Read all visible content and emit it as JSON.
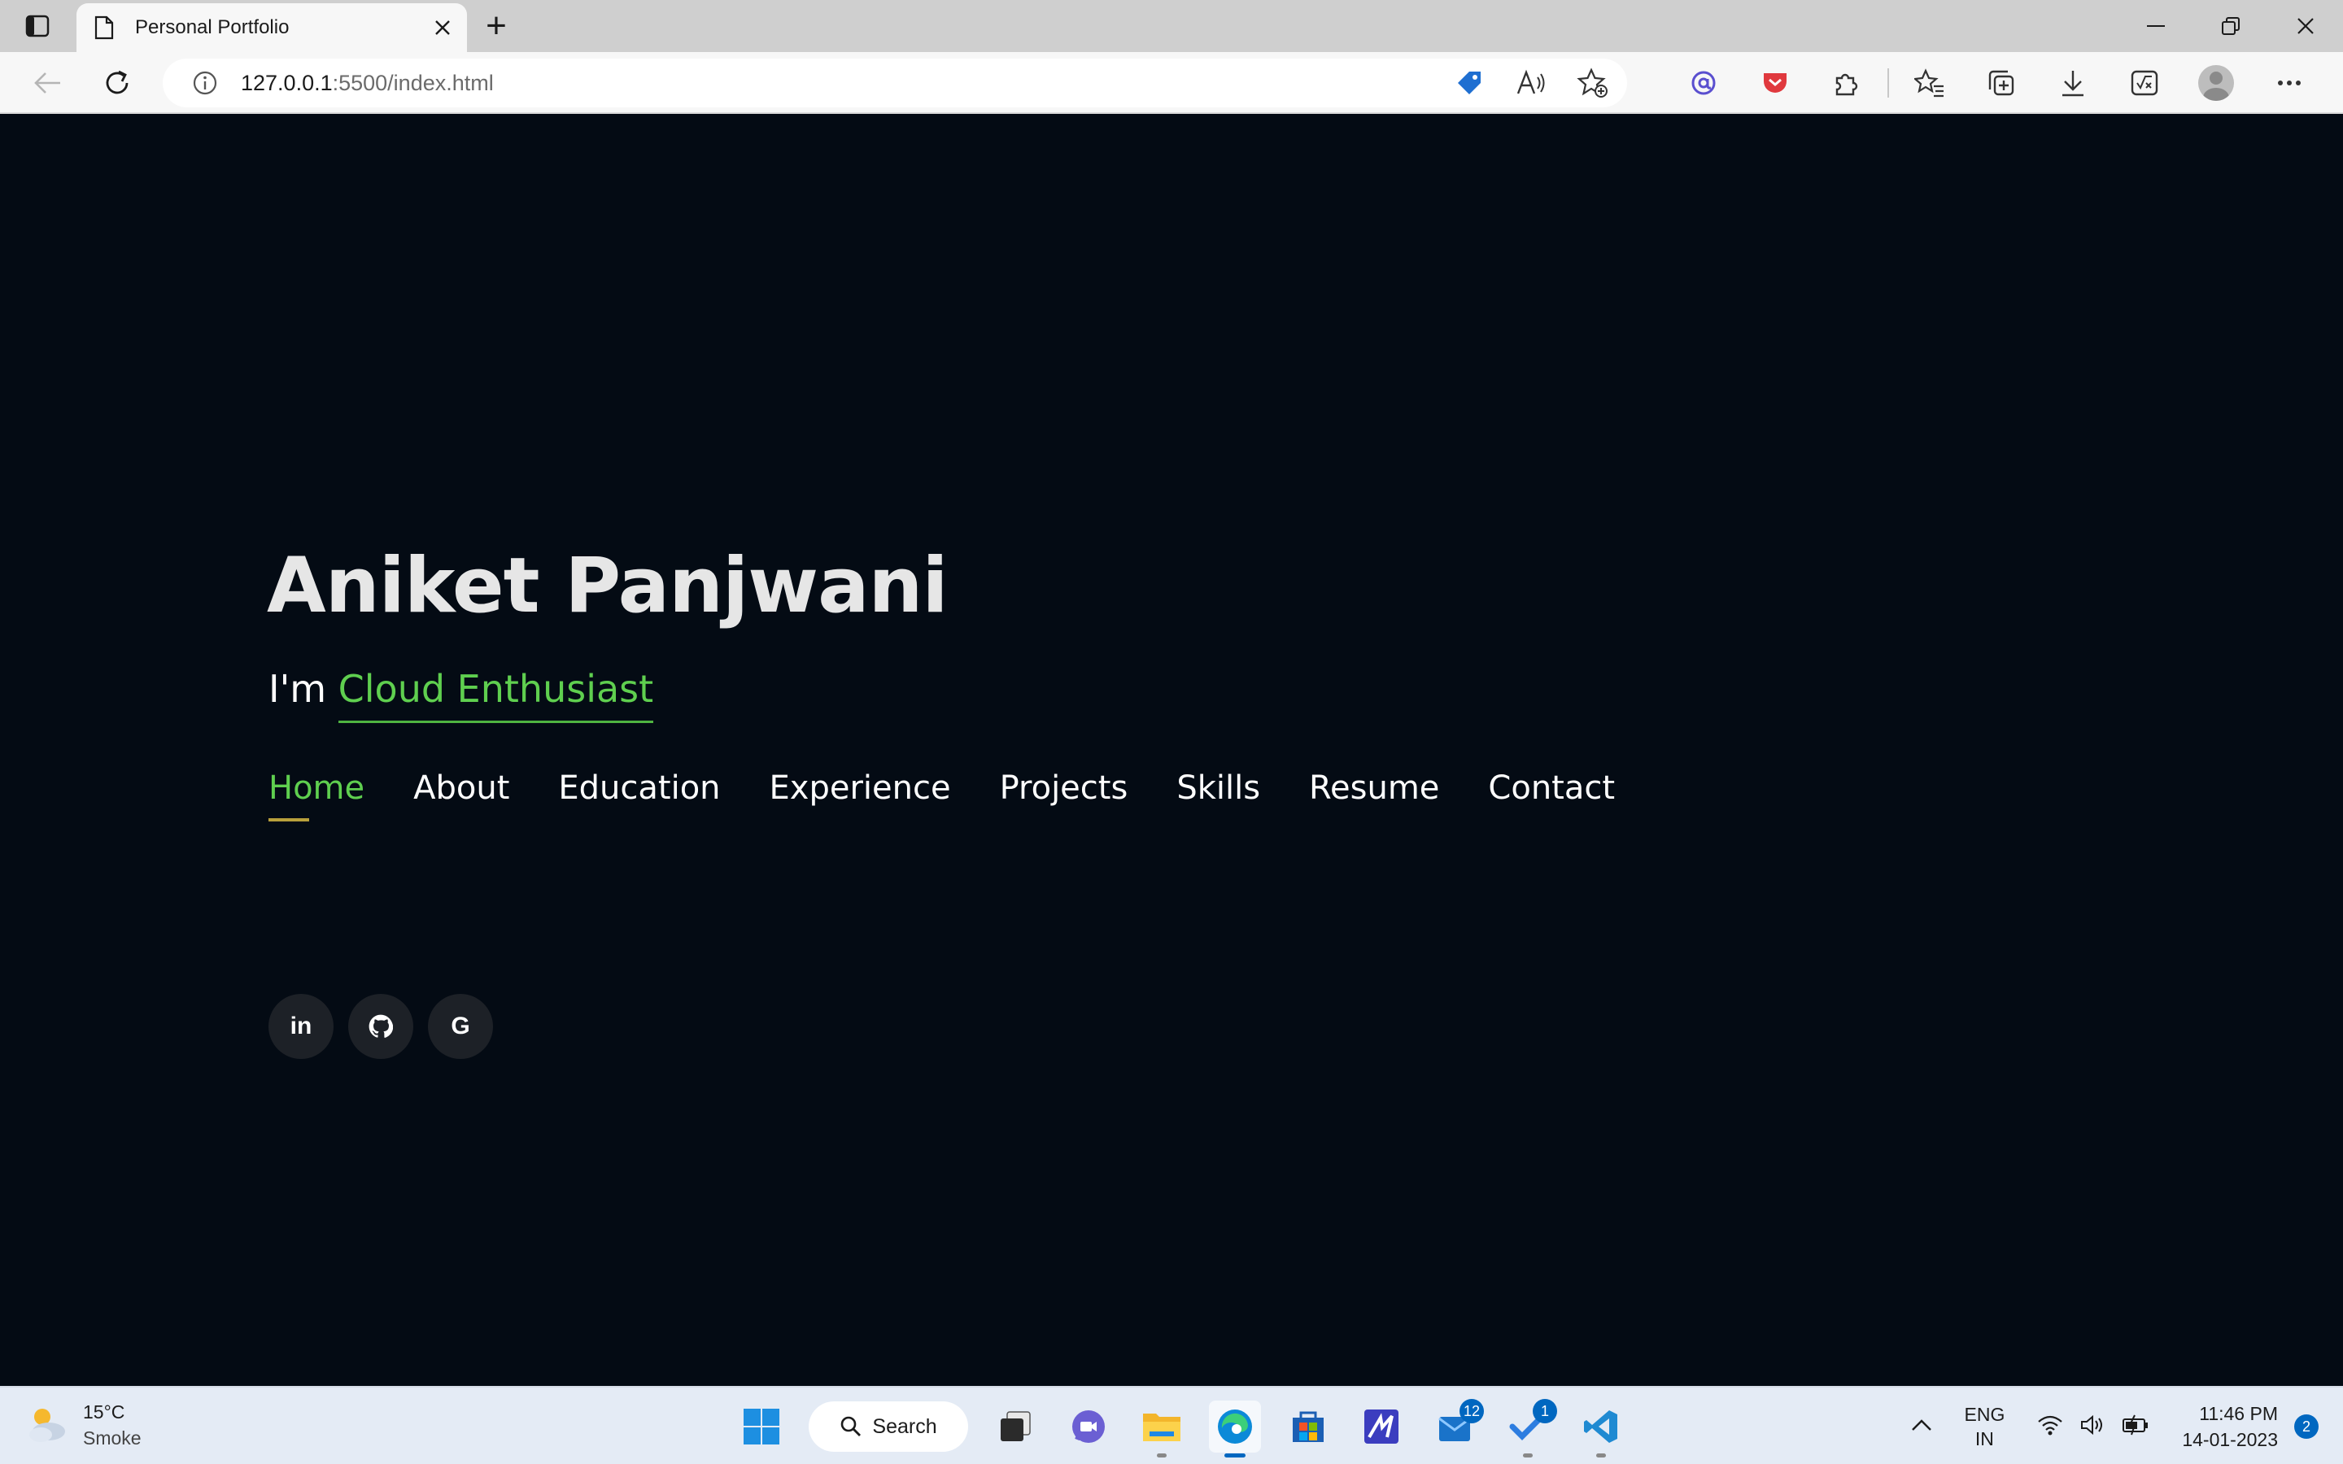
{
  "browser": {
    "tab_title": "Personal Portfolio",
    "new_tab_symbol": "+",
    "url_host": "127.0.0.1",
    "url_rest": ":5500/index.html"
  },
  "hero": {
    "name": "Aniket Panjwani",
    "prefix": "I'm",
    "role": "Cloud Enthusiast"
  },
  "nav": {
    "items": [
      {
        "label": "Home",
        "active": true
      },
      {
        "label": "About"
      },
      {
        "label": "Education"
      },
      {
        "label": "Experience"
      },
      {
        "label": "Projects"
      },
      {
        "label": "Skills"
      },
      {
        "label": "Resume"
      },
      {
        "label": "Contact"
      }
    ]
  },
  "socials": [
    {
      "icon": "linkedin-icon",
      "glyph": "in"
    },
    {
      "icon": "github-icon"
    },
    {
      "icon": "google-icon",
      "glyph": "G"
    }
  ],
  "taskbar": {
    "weather_temp": "15°C",
    "weather_desc": "Smoke",
    "search_label": "Search",
    "badge_mail": "12",
    "badge_todo": "1",
    "lang_line1": "ENG",
    "lang_line2": "IN",
    "time": "11:46 PM",
    "date": "14-01-2023",
    "notification_count": "2"
  },
  "colors": {
    "page_bg": "#040b14",
    "accent_green": "#5fcf4f",
    "underline_gold": "#b8a03c",
    "social_bg": "#1d2127"
  }
}
